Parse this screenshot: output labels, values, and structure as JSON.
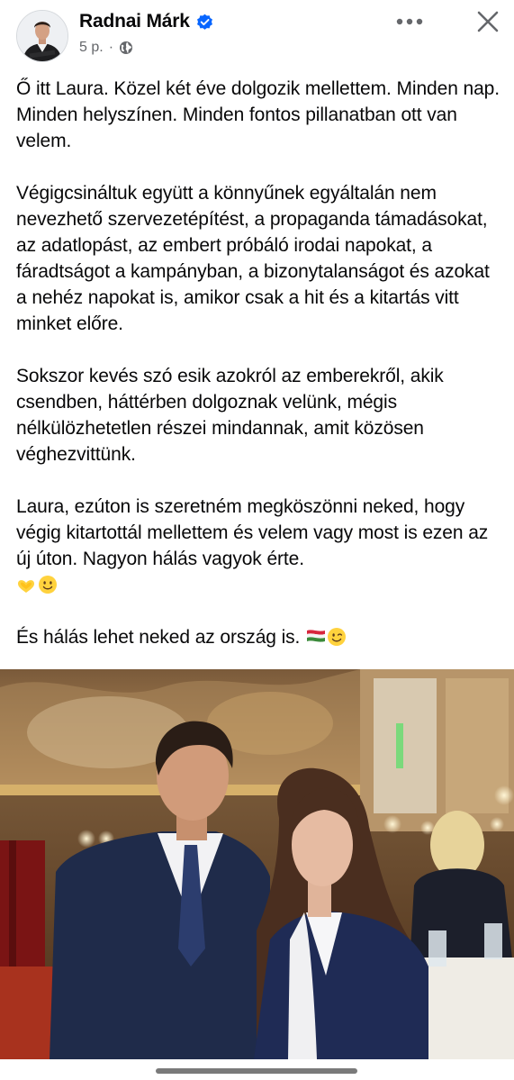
{
  "post": {
    "author": "Radnai Márk",
    "time": "5 p.",
    "separator": "·",
    "paragraphs": [
      "Ő itt Laura. Közel két éve dolgozik mellettem. Minden nap. Minden helyszínen. Minden fontos pillanatban ott van velem.",
      "Végigcsináltuk együtt a könnyűnek egyáltalán nem nevezhető szervezetépítést, a propaganda támadásokat, az adatlopást, az embert próbáló irodai napokat, a fáradtságot a kampányban, a bizonytalanságot és azokat a nehéz napokat is, amikor csak a hit és a kitartás vitt minket előre.",
      "Sokszor kevés szó esik azokról az emberekről, akik csendben, háttérben dolgoznak velünk, mégis nélkülözhetetlen részei mindannak, amit közösen véghezvittünk.",
      "Laura, ezúton is szeretném megköszönni neked, hogy végig kitartottál mellettem és velem vagy most is ezen az új úton. Nagyon hálás vagyok érte."
    ],
    "last_paragraph": "És hálás lehet neked az ország is.",
    "emoji_names": [
      "heart-hands-icon",
      "smiling-face-icon",
      "hungary-flag-icon",
      "winking-face-icon"
    ]
  },
  "colors": {
    "text": "#080809",
    "meta": "#65676b",
    "verified": "#0866ff"
  }
}
